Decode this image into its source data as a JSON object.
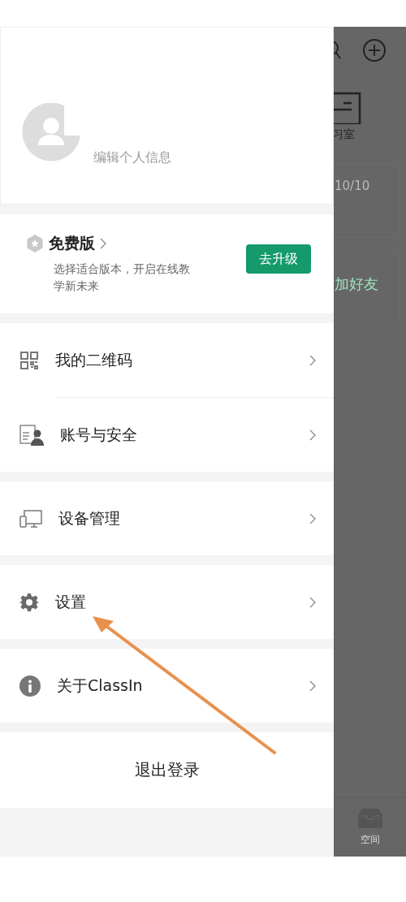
{
  "profile": {
    "edit_label": "编辑个人信息"
  },
  "plan": {
    "name": "免费版",
    "description": "选择适合版本，开启在线教学新未来",
    "upgrade_button": "去升级"
  },
  "menu_groups": [
    [
      {
        "kind": "qr",
        "label": "我的二维码"
      },
      {
        "kind": "account",
        "label": "账号与安全"
      }
    ],
    [
      {
        "kind": "device",
        "label": "设备管理"
      }
    ],
    [
      {
        "kind": "settings",
        "label": "设置"
      }
    ],
    [
      {
        "kind": "info",
        "label": "关于ClassIn"
      }
    ]
  ],
  "logout": "退出登录",
  "background": {
    "study_room_label": "习室",
    "counter": "10/10",
    "add_friend": "加好友",
    "tab_label": "空间"
  }
}
